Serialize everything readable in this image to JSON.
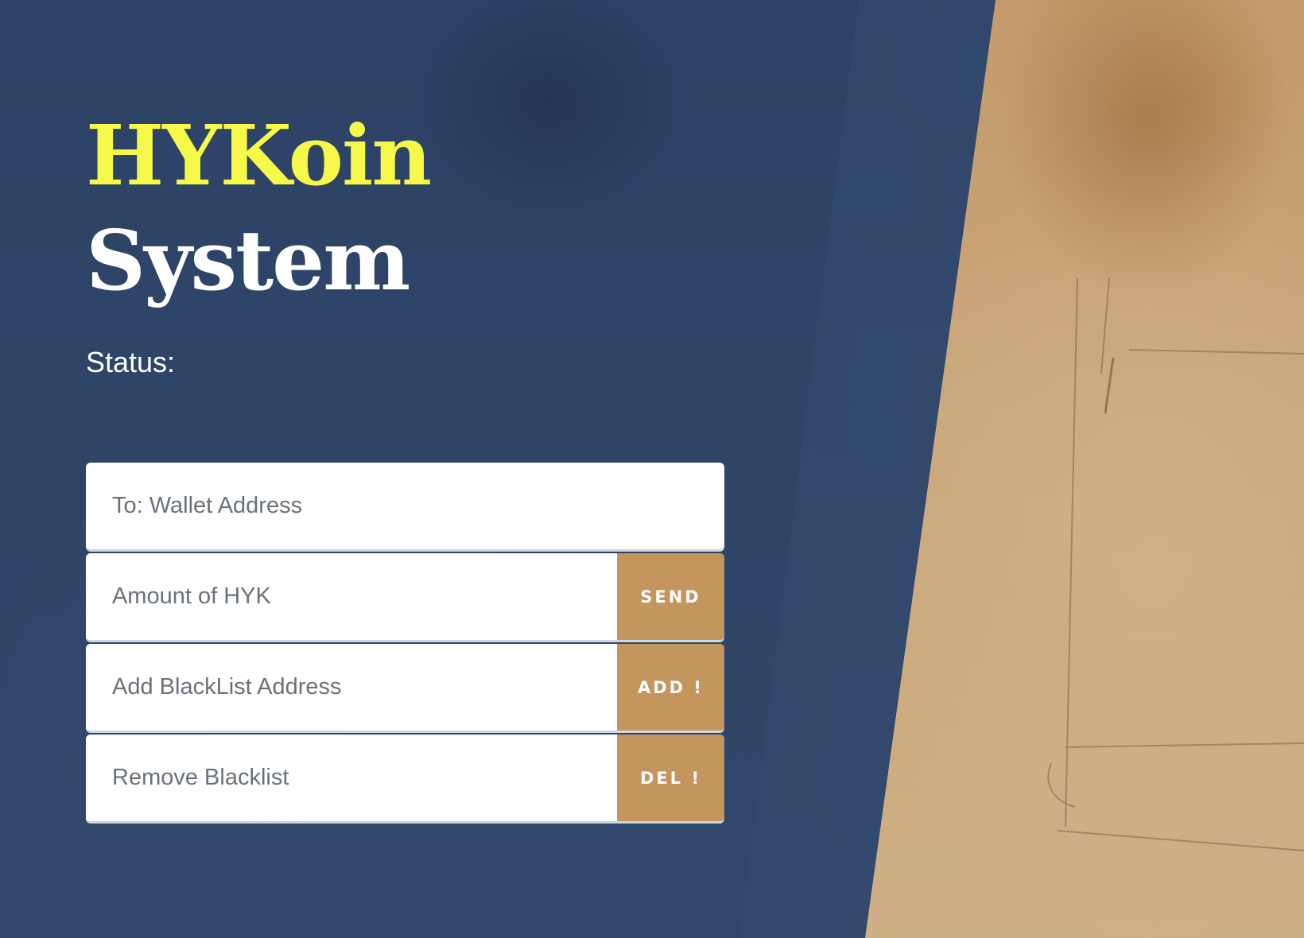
{
  "brand": {
    "title_line1": "HYKoin",
    "title_line2": "System"
  },
  "status": {
    "label": "Status:",
    "value": ""
  },
  "form": {
    "wallet_address": {
      "placeholder": "To: Wallet Address",
      "value": ""
    },
    "amount": {
      "placeholder": "Amount of HYK",
      "value": "",
      "button_label": "SEND"
    },
    "add_blacklist": {
      "placeholder": "Add BlackList Address",
      "value": "",
      "button_label": "ADD !"
    },
    "remove_blacklist": {
      "placeholder": "Remove Blacklist",
      "value": "",
      "button_label": "DEL !"
    }
  },
  "colors": {
    "panel": "#2d4466",
    "accent": "#c4955d",
    "brand_yellow": "#f6f84a",
    "photo": "#c9a57b"
  }
}
